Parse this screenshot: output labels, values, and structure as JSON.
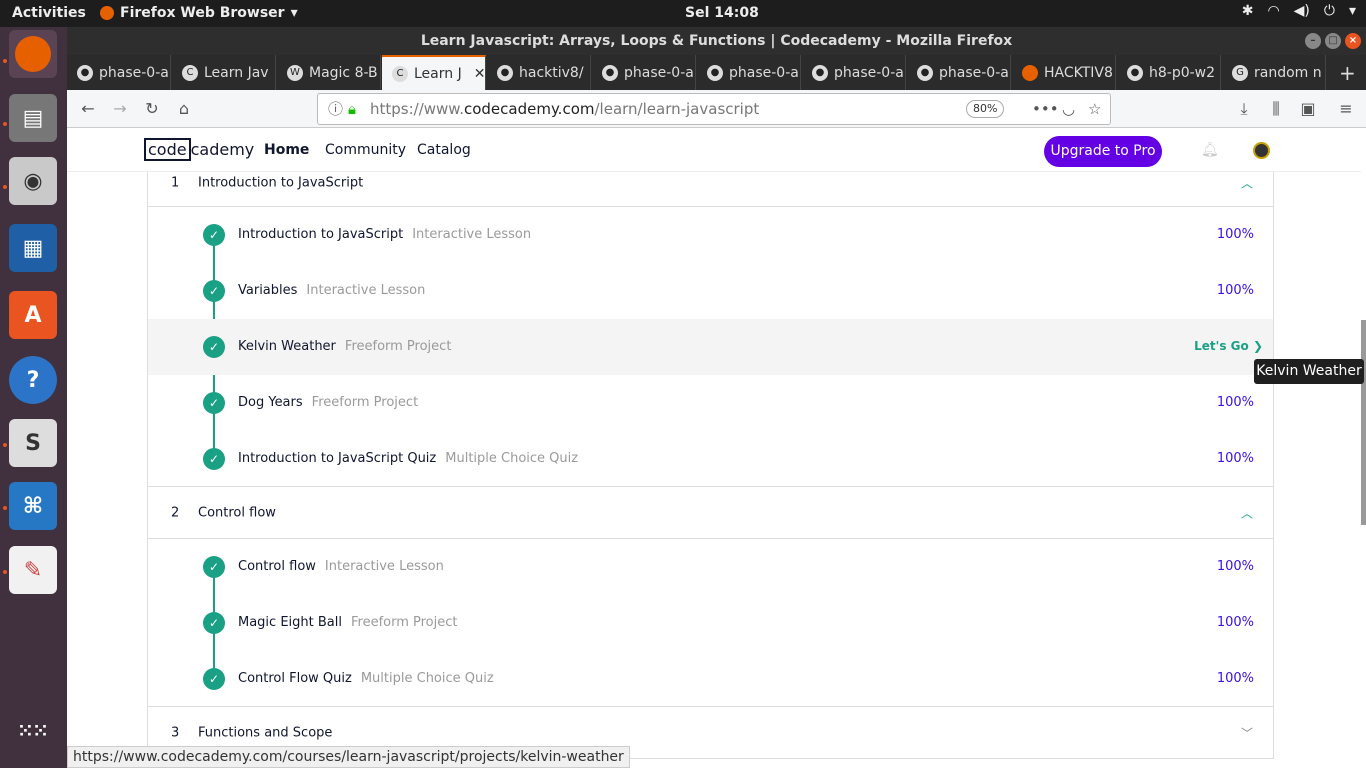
{
  "topbar": {
    "activities": "Activities",
    "app": "Firefox Web Browser",
    "clock": "Sel 14:08"
  },
  "window": {
    "title": "Learn Javascript: Arrays, Loops & Functions | Codecademy - Mozilla Firefox"
  },
  "tabs": [
    {
      "label": "phase-0-a"
    },
    {
      "label": "Learn Jav"
    },
    {
      "label": "Magic 8-B"
    },
    {
      "label": "Learn J"
    },
    {
      "label": "hacktiv8/"
    },
    {
      "label": "phase-0-a"
    },
    {
      "label": "phase-0-a"
    },
    {
      "label": "phase-0-a"
    },
    {
      "label": "phase-0-a"
    },
    {
      "label": "HACKTIV8"
    },
    {
      "label": "h8-p0-w2"
    },
    {
      "label": "random n"
    }
  ],
  "nav": {
    "url_prefix": "https://www.",
    "url_domain": "codecademy.com",
    "url_path": "/learn/learn-javascript",
    "zoom": "80%"
  },
  "site": {
    "logo_a": "code",
    "logo_b": "cademy",
    "home": "Home",
    "community": "Community",
    "catalog": "Catalog",
    "upgrade": "Upgrade to Pro"
  },
  "sections": [
    {
      "num": "1",
      "title": "Introduction to JavaScript",
      "lessons": [
        {
          "name": "Introduction to JavaScript",
          "type": "Interactive Lesson",
          "progress": "100%"
        },
        {
          "name": "Variables",
          "type": "Interactive Lesson",
          "progress": "100%"
        },
        {
          "name": "Kelvin Weather",
          "type": "Freeform Project",
          "progress": "Let's Go"
        },
        {
          "name": "Dog Years",
          "type": "Freeform Project",
          "progress": "100%"
        },
        {
          "name": "Introduction to JavaScript Quiz",
          "type": "Multiple Choice Quiz",
          "progress": "100%"
        }
      ]
    },
    {
      "num": "2",
      "title": "Control flow",
      "lessons": [
        {
          "name": "Control flow",
          "type": "Interactive Lesson",
          "progress": "100%"
        },
        {
          "name": "Magic Eight Ball",
          "type": "Freeform Project",
          "progress": "100%"
        },
        {
          "name": "Control Flow Quiz",
          "type": "Multiple Choice Quiz",
          "progress": "100%"
        }
      ]
    },
    {
      "num": "3",
      "title": "Functions and Scope"
    }
  ],
  "tooltip": "Kelvin Weather",
  "status_url": "https://www.codecademy.com/courses/learn-javascript/projects/kelvin-weather",
  "colors": {
    "accent": "#1aa085",
    "brand": "#6400e4",
    "progress": "#3a10e5"
  }
}
